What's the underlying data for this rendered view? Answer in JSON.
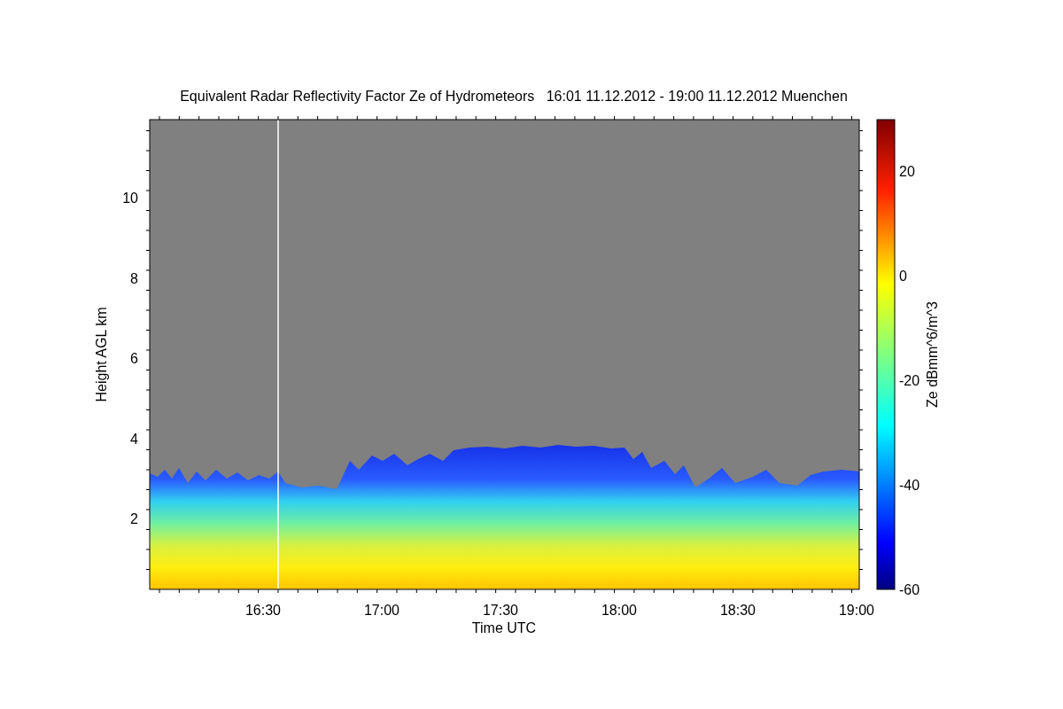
{
  "plot": {
    "title": "Equivalent Radar Reflectivity Factor Ze of Hydrometeors   16:01 11.12.2012 - 19:00 11.12.2012 Muenchen",
    "xlabel": "Time UTC",
    "ylabel": "Height AGL km",
    "xtick_labels": [
      "16:30",
      "17:00",
      "17:30",
      "18:00",
      "18:30",
      "19:00"
    ],
    "ytick_labels": [
      "10",
      "8",
      "6",
      "4",
      "2"
    ]
  },
  "colorbar": {
    "label": "Ze dBmm^6/m^3",
    "tick_labels": [
      "20",
      "0",
      "-20",
      "-40",
      "-60"
    ]
  }
}
